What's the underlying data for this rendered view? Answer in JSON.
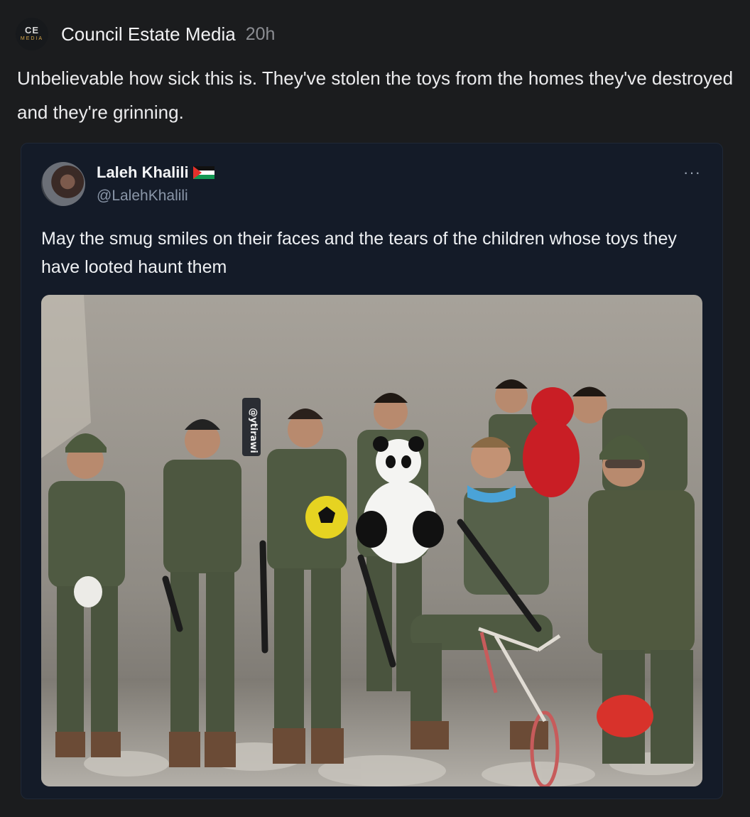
{
  "post": {
    "logo_text_top": "CE",
    "logo_text_bottom": "MEDIA",
    "author": "Council Estate Media",
    "time": "20h",
    "body": "Unbelievable how sick this is. They've stolen the toys from the homes they've destroyed and they're grinning."
  },
  "quoted": {
    "name": "Laleh Khalili",
    "handle": "@LalehKhalili",
    "more": "···",
    "text": "May the smug smiles on their faces and the tears of the children whose toys they have looted haunt them",
    "photo_watermark": "@ytirawi"
  },
  "colors": {
    "background": "#1b1c1e",
    "card": "#141b28",
    "muted": "#8b8d92"
  }
}
